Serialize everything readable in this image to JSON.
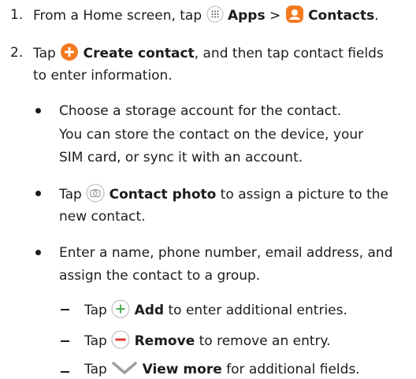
{
  "steps": [
    {
      "number": "1.",
      "pre": "From a Home screen, tap",
      "apps": "Apps",
      "sep": ">",
      "contacts": "Contacts",
      "end": "."
    },
    {
      "number": "2.",
      "tap": "Tap",
      "create": "Create contact",
      "rest": ", and then tap contact fields",
      "line2": "to enter information."
    }
  ],
  "bullets": [
    {
      "line1": "Choose a storage account for the contact.",
      "line2": "You can store the contact on the device, your",
      "line3": "SIM card, or sync it with an account."
    },
    {
      "tap": "Tap",
      "label": "Contact photo",
      "rest": "to assign a picture to the",
      "line2": "new contact."
    },
    {
      "line1": "Enter a name, phone number, email address, and",
      "line2": "assign the contact to a group."
    }
  ],
  "subitems": [
    {
      "tap": "Tap",
      "label": "Add",
      "rest": "to enter additional entries."
    },
    {
      "tap": "Tap",
      "label": "Remove",
      "rest": "to remove an entry."
    },
    {
      "tap": "Tap",
      "label": "View more",
      "rest": "for additional fields."
    }
  ],
  "colors": {
    "text": "#1c1c1c",
    "orange": "#f47a20",
    "green": "#4caf50",
    "red": "#e53935",
    "gray_icon": "#9e9e9e"
  },
  "icons": [
    "apps-icon",
    "contacts-icon",
    "create-contact-icon",
    "camera-icon",
    "add-icon",
    "remove-icon",
    "view-more-icon"
  ]
}
